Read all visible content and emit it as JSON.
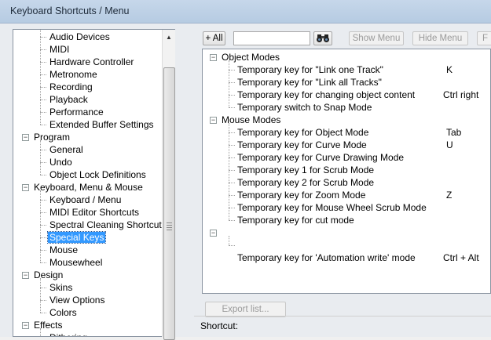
{
  "window": {
    "title": "Keyboard Shortcuts / Menu"
  },
  "tree": {
    "items": [
      {
        "label": "Audio Devices",
        "level": 2
      },
      {
        "label": "MIDI",
        "level": 2
      },
      {
        "label": "Hardware Controller",
        "level": 2
      },
      {
        "label": "Metronome",
        "level": 2
      },
      {
        "label": "Recording",
        "level": 2
      },
      {
        "label": "Playback",
        "level": 2
      },
      {
        "label": "Performance",
        "level": 2
      },
      {
        "label": "Extended Buffer Settings",
        "level": 2
      },
      {
        "label": "Program",
        "level": 1
      },
      {
        "label": "General",
        "level": 2
      },
      {
        "label": "Undo",
        "level": 2
      },
      {
        "label": "Object Lock Definitions",
        "level": 2
      },
      {
        "label": "Keyboard, Menu & Mouse",
        "level": 1
      },
      {
        "label": "Keyboard / Menu",
        "level": 2
      },
      {
        "label": "MIDI Editor Shortcuts",
        "level": 2
      },
      {
        "label": "Spectral Cleaning Shortcuts",
        "level": 2
      },
      {
        "label": "Special Keys",
        "level": 2,
        "selected": true
      },
      {
        "label": "Mouse",
        "level": 2
      },
      {
        "label": "Mousewheel",
        "level": 2
      },
      {
        "label": "Design",
        "level": 1
      },
      {
        "label": "Skins",
        "level": 2
      },
      {
        "label": "View Options",
        "level": 2
      },
      {
        "label": "Colors",
        "level": 2
      },
      {
        "label": "Effects",
        "level": 1
      },
      {
        "label": "Dithering",
        "level": 2
      }
    ]
  },
  "toolbar": {
    "expand_all": "+ All",
    "search_placeholder": "",
    "show_menu": "Show Menu",
    "hide_menu": "Hide Menu",
    "cut_button": "F"
  },
  "list": {
    "groups": [
      {
        "name": "Object Modes",
        "items": [
          {
            "label": "Temporary key for \"Link one Track\"",
            "key": "K"
          },
          {
            "label": "Temporary key for \"Link all Tracks\"",
            "key": ""
          },
          {
            "label": "Temporary key for changing object content",
            "key": "Ctrl right"
          },
          {
            "label": "Temporary switch to Snap Mode",
            "key": ""
          }
        ]
      },
      {
        "name": "Mouse Modes",
        "items": [
          {
            "label": "Temporary key for Object Mode",
            "key": "Tab"
          },
          {
            "label": "Temporary key for Curve Mode",
            "key": "U"
          },
          {
            "label": "Temporary key for Curve Drawing Mode",
            "key": ""
          },
          {
            "label": "Temporary key 1 for Scrub Mode",
            "key": ""
          },
          {
            "label": "Temporary key 2 for Scrub Mode",
            "key": ""
          },
          {
            "label": "Temporary key for Zoom Mode",
            "key": "Z"
          },
          {
            "label": "Temporary key for Mouse Wheel Scrub Mode",
            "key": ""
          },
          {
            "label": "Temporary key for cut mode",
            "key": ""
          }
        ]
      },
      {
        "name": "",
        "items": [
          {
            "label": "Temporary key for 'Automation write' mode",
            "key": "Ctrl + Alt"
          }
        ]
      }
    ]
  },
  "footer": {
    "export_list": "Export list...",
    "shortcut_label": "Shortcut:"
  },
  "colors": {
    "selection": "#3399ff",
    "titlebar": "#c6d7ea"
  }
}
